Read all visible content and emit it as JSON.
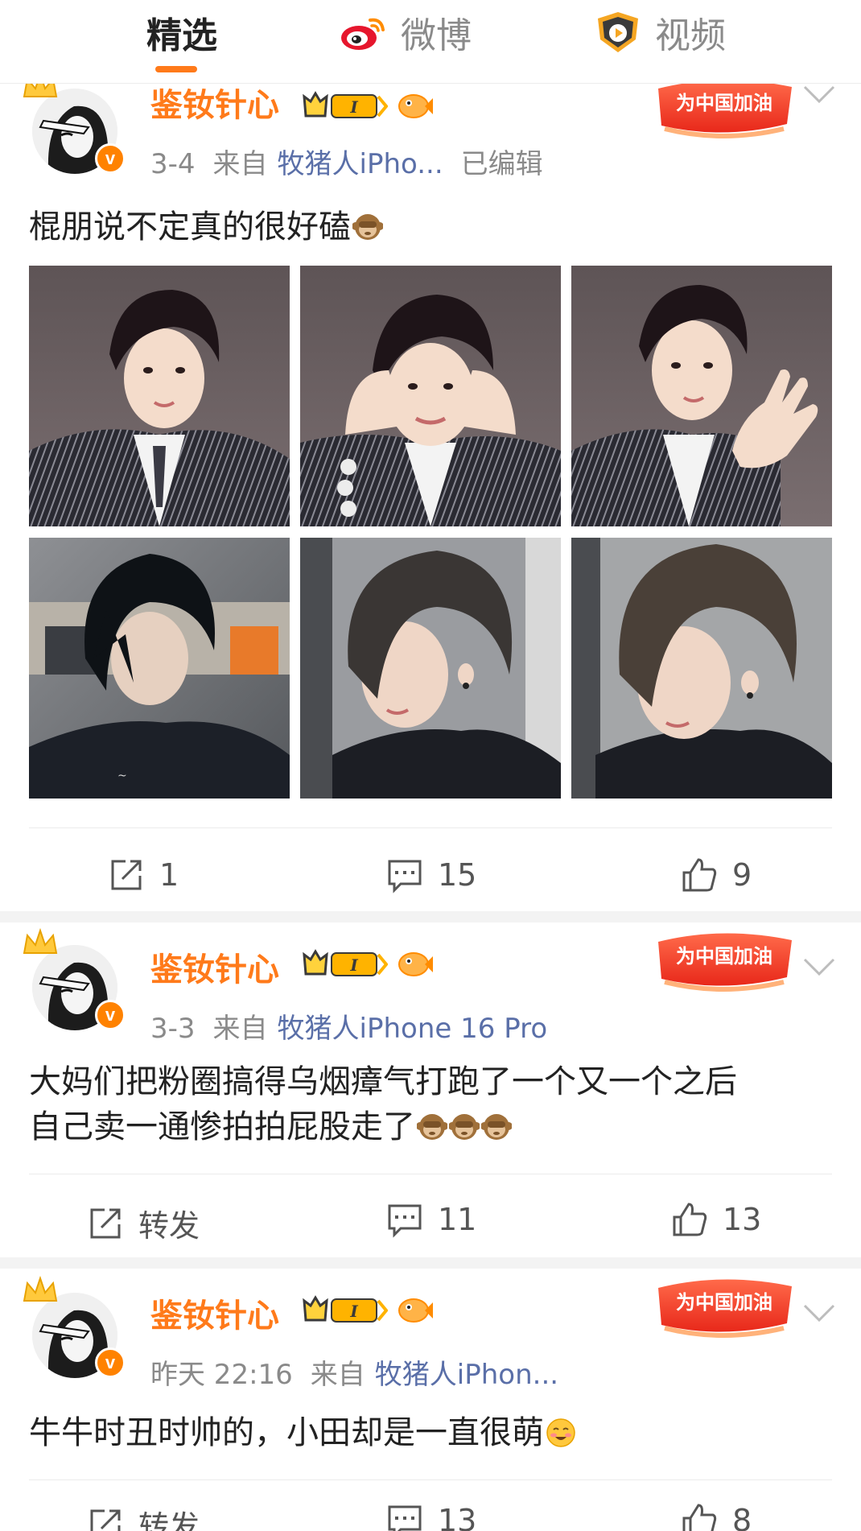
{
  "tabs": [
    {
      "label": "精选",
      "active": true
    },
    {
      "label": "微博",
      "icon": "weibo-logo-icon"
    },
    {
      "label": "视频",
      "icon": "video-channel-icon"
    }
  ],
  "accent_color": "#ff7a1a",
  "link_color": "#5a6fa8",
  "posts": [
    {
      "username": "鉴钕针心",
      "time": "3-4",
      "from_label": "来自",
      "source": "牧猪人iPho...",
      "edited": "已编辑",
      "text": "棍朋说不定真的很好磕",
      "emojis": [
        "monkey-emoji-icon"
      ],
      "images": [
        "photo-1",
        "photo-2",
        "photo-3",
        "photo-4",
        "photo-5",
        "photo-6"
      ],
      "actions": {
        "repost": "1",
        "comment": "15",
        "like": "9"
      }
    },
    {
      "username": "鉴钕针心",
      "time": "3-3",
      "from_label": "来自",
      "source": "牧猪人iPhone 16 Pro",
      "text_lines": [
        "大妈们把粉圈搞得乌烟瘴气打跑了一个又一个之后",
        "自己卖一通惨拍拍屁股走了"
      ],
      "emojis": [
        "monkey-emoji-icon",
        "monkey-emoji-icon",
        "monkey-emoji-icon"
      ],
      "actions": {
        "repost": "转发",
        "comment": "11",
        "like": "13"
      }
    },
    {
      "username": "鉴钕针心",
      "time": "昨天 22:16",
      "from_label": "来自",
      "source": "牧猪人iPhon...",
      "text": "牛牛时丑时帅的，小田却是一直很萌",
      "emojis": [
        "blush-smile-emoji-icon"
      ],
      "actions": {
        "repost": "转发",
        "comment": "13",
        "like": "8"
      }
    }
  ],
  "badges": {
    "vip_level": "I",
    "promo_text": "为中国加油"
  }
}
